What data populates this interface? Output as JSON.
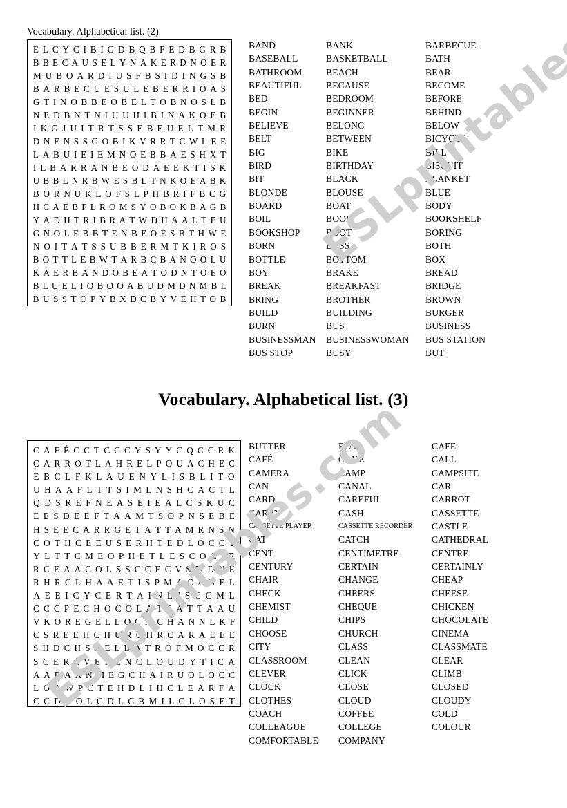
{
  "watermark": {
    "line1": "ESLprintables.com",
    "line2": "ESLprintables.com"
  },
  "section1": {
    "title": "Vocabulary. Alphabetical list. (2)",
    "grid": {
      "rows": 20,
      "cols": 18,
      "letters": [
        "ELCYCIBIGDBQBFEDBGRB",
        "BBECAUSELYNAKERDNOER",
        "MUBOARDIUSFBSIDINGSB",
        "BARBECUESULEBERRIOAS",
        "GTINOBBEOBELTOBNOSLB",
        "NEDBNTNIUUHIBINAKOEB",
        "IKGJUITRTSSEBEUELTMR",
        "DNENSSGOBIKVRRTCWLEE",
        "LABUIEIEMNOEBBAESHXT",
        "ILBARRANBEODAEEKTISK",
        "UBBLNRBWESBLTNKOEABK",
        "BORNUKLOFSLPHBRIFBCG",
        "HCAEBFLROMSYOBOKBAGB",
        "YADHTRIBRATWDHAALTEU",
        "GNOLEBBTENBEOESBTHWE",
        "NOITATSSUBBERMTKIROS",
        "BOTTLEBWTARBCBANOOLU",
        "KAERBANDOBEATODNTOEO",
        "BLUELIOBOOABUDMDNMBL",
        "BUSSTOPYBXDCBYVEHTOB"
      ]
    },
    "word_columns": [
      [
        "BAND",
        "BASEBALL",
        "BATHROOM",
        "BEAUTIFUL",
        "BED",
        "BEGIN",
        "BELIEVE",
        "BELT",
        "BIG",
        "BIRD",
        "BIT",
        "BLONDE",
        "BOARD",
        "BOIL",
        "BOOKSHOP",
        "BORN",
        "BOTTLE",
        "BOY",
        "BREAK",
        "BRING",
        "BUILD",
        "BURN",
        "BUSINESSMAN",
        "BUS STOP"
      ],
      [
        "BANK",
        "BASKETBALL",
        "BEACH",
        "BECAUSE",
        "BEDROOM",
        "BEGINNER",
        "BELONG",
        "BETWEEN",
        "BIKE",
        "BIRTHDAY",
        "BLACK",
        "BLOUSE",
        "BOAT",
        "BOOK",
        "BOOT",
        "BOSS",
        "BOTTOM",
        "BRAKE",
        "BREAKFAST",
        "BROTHER",
        "BUILDING",
        "BUS",
        "BUSINESSWOMAN",
        "BUSY"
      ],
      [
        "BARBECUE",
        "BATH",
        "BEAR",
        "BECOME",
        "BEFORE",
        "BEHIND",
        "BELOW",
        "BICYCLE",
        "BILL",
        "BISCUIT",
        "BLANKET",
        "BLUE",
        "BODY",
        "BOOKSHELF",
        "BORING",
        "BOTH",
        "BOX",
        "BREAD",
        "BRIDGE",
        "BROWN",
        "BURGER",
        "BUSINESS",
        "BUS STATION",
        "BUT"
      ]
    ]
  },
  "section2": {
    "title": "Vocabulary. Alphabetical list. (3)",
    "grid": {
      "rows": 20,
      "cols": 18,
      "letters": [
        "CAFÉCCTCCCYSYYCQCCRK",
        "CARROTLAHRELPOUACHEC",
        "EBCLFKLAUENYLISBLITO",
        "UHAAFLTTSIMLNSHCACTL",
        "QDSREFNEASEIEALCSKUC",
        "EESDEEFTAAMTSOPNSEBE",
        "HSEECARRGETATTAMRNSN",
        "COTHCEEUSERHTEDLOCCT",
        "YLTTCMEOPHETLESCOCIR",
        "RCEAACOLSSCCECVSMDNE",
        "RHRCLHAAETISPMACAHEL",
        "AEEICYCERTAINLISCCML",
        "CCCPECHOCOLATEATTAAU",
        "VKOREGELLOCMCHANNLKF",
        "CSREEHCHURCHRCARAEEE",
        "SHDCHSRELBATROFMOCCR",
        "SCEREVELCNCLOUDYTICA",
        "AARAANMEGCHAIRUOLOCC",
        "LOAWPCTEHDLIHCLEARFA",
        "CCDUOLCDLCBMILCLOSET"
      ]
    },
    "word_columns": [
      [
        "BUTTER",
        "CAFÉ",
        "CAMERA",
        "CAN",
        "CARD",
        "CARRY",
        "CASSETTE PLAYER",
        "CAT",
        "CENT",
        "CENTURY",
        "CHAIR",
        "CHECK",
        "CHEMIST",
        "CHILD",
        "CHOOSE",
        "CITY",
        "CLASSROOM",
        "CLEVER",
        "CLOCK",
        "CLOTHES",
        "COACH",
        "COLLEAGUE",
        "COMFORTABLE"
      ],
      [
        "BUY",
        "CAKE",
        "CAMP",
        "CANAL",
        "CAREFUL",
        "CASH",
        "CASSETTE RECORDER",
        "CATCH",
        "CENTIMETRE",
        "CERTAIN",
        "CHANGE",
        "CHEERS",
        "CHEQUE",
        "CHIPS",
        "CHURCH",
        "CLASS",
        "CLEAN",
        "CLICK",
        "CLOSE",
        "CLOUD",
        "COFFEE",
        "COLLEGE",
        "COMPANY"
      ],
      [
        "CAFE",
        "CALL",
        "CAMPSITE",
        "CAR",
        "CARROT",
        "CASSETTE",
        "CASTLE",
        "CATHEDRAL",
        "CENTRE",
        "CERTAINLY",
        "CHEAP",
        "CHEESE",
        "CHICKEN",
        "CHOCOLATE",
        "CINEMA",
        "CLASSMATE",
        "CLEAR",
        "CLIMB",
        "CLOSED",
        "CLOUDY",
        "COLD",
        "COLOUR",
        ""
      ]
    ],
    "small_font_items": [
      "CASSETTE PLAYER",
      "CASSETTE RECORDER"
    ]
  }
}
